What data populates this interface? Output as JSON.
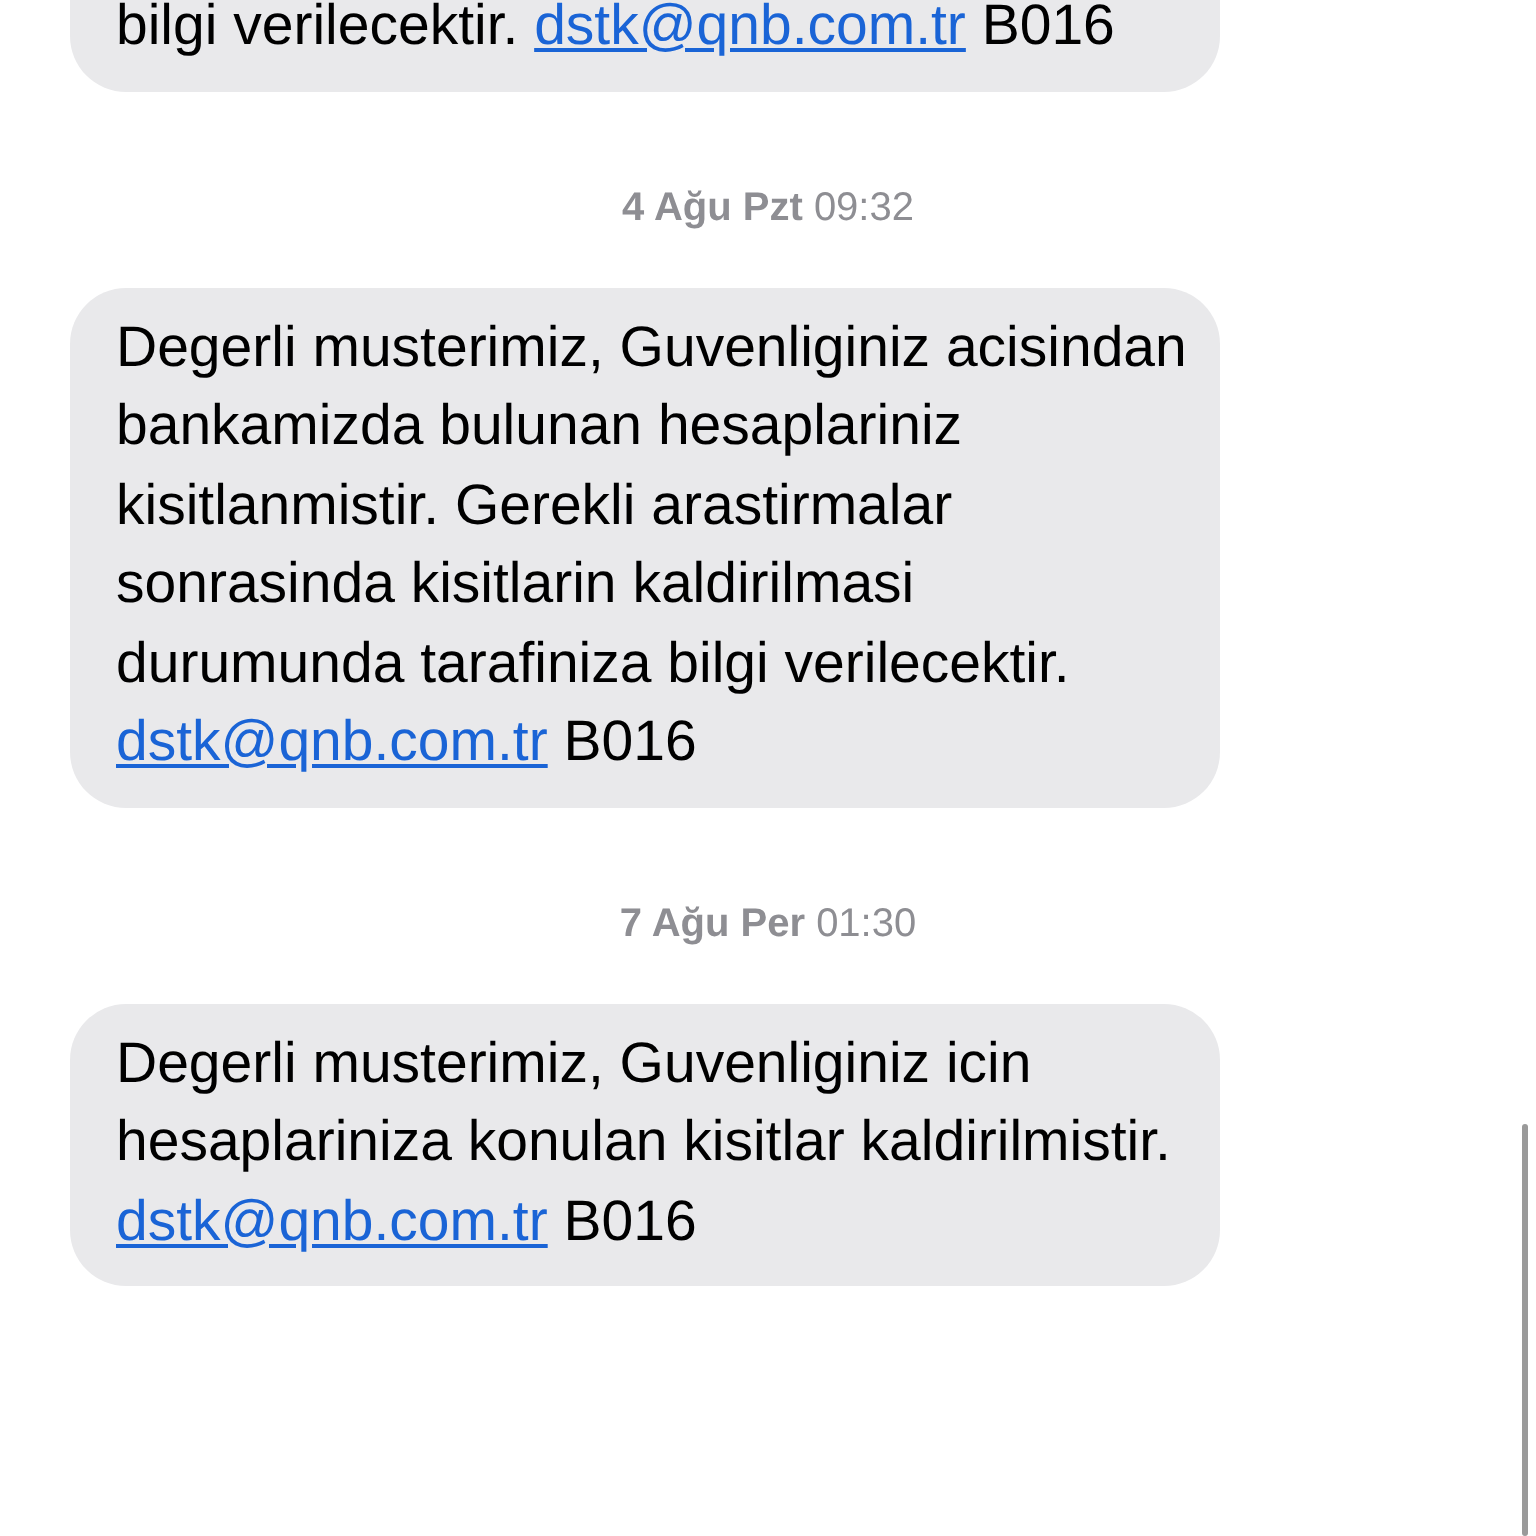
{
  "messages": [
    {
      "kind": "message",
      "text": "bilgi verilecektir.",
      "link": "dstk@qnb.com.tr",
      "code": "B016"
    },
    {
      "kind": "timestamp",
      "day": "4 Ağu Pzt",
      "time": "09:32"
    },
    {
      "kind": "message",
      "text": "Degerli musterimiz, Guvenliginiz acisindan bankamizda bulunan hesaplariniz kisitlanmistir. Gerekli arastirmalar sonrasinda kisitlarin kaldirilmasi durumunda tarafiniza bilgi verilecektir.",
      "link": "dstk@qnb.com.tr",
      "code": "B016"
    },
    {
      "kind": "timestamp",
      "day": "7 Ağu Per",
      "time": "01:30"
    },
    {
      "kind": "message",
      "text": "Degerli musterimiz, Guvenliginiz icin hesaplariniza konulan kisitlar kaldirilmistir.",
      "link": "dstk@qnb.com.tr",
      "code": "B016"
    }
  ]
}
